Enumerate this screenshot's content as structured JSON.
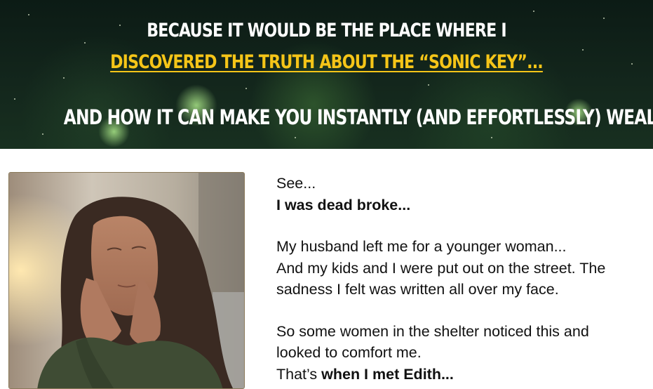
{
  "hero": {
    "line1": "BECAUSE IT WOULD BE THE PLACE WHERE I",
    "line2": "DISCOVERED THE TRUTH ABOUT THE “SONIC KEY”...",
    "line3": "AND HOW IT CAN MAKE YOU INSTANTLY (AND EFFORTLESSLY) WEALTHY."
  },
  "story": {
    "p1_line1": "See...",
    "p1_line2": "I was dead broke...",
    "p2_line1": "My husband left me for a younger woman...",
    "p2_line2": "And my kids and I were put out on the street. The",
    "p2_line3": "sadness I felt was written all over my face.",
    "p3_line1": "So some women in the shelter noticed this and",
    "p3_line2": "looked to comfort me.",
    "p3_line3_prefix": "That’s ",
    "p3_line3_bold": "when I met Edith..."
  },
  "colors": {
    "accent_yellow": "#f5c518",
    "hero_bg": "#13261c",
    "text": "#111111"
  }
}
